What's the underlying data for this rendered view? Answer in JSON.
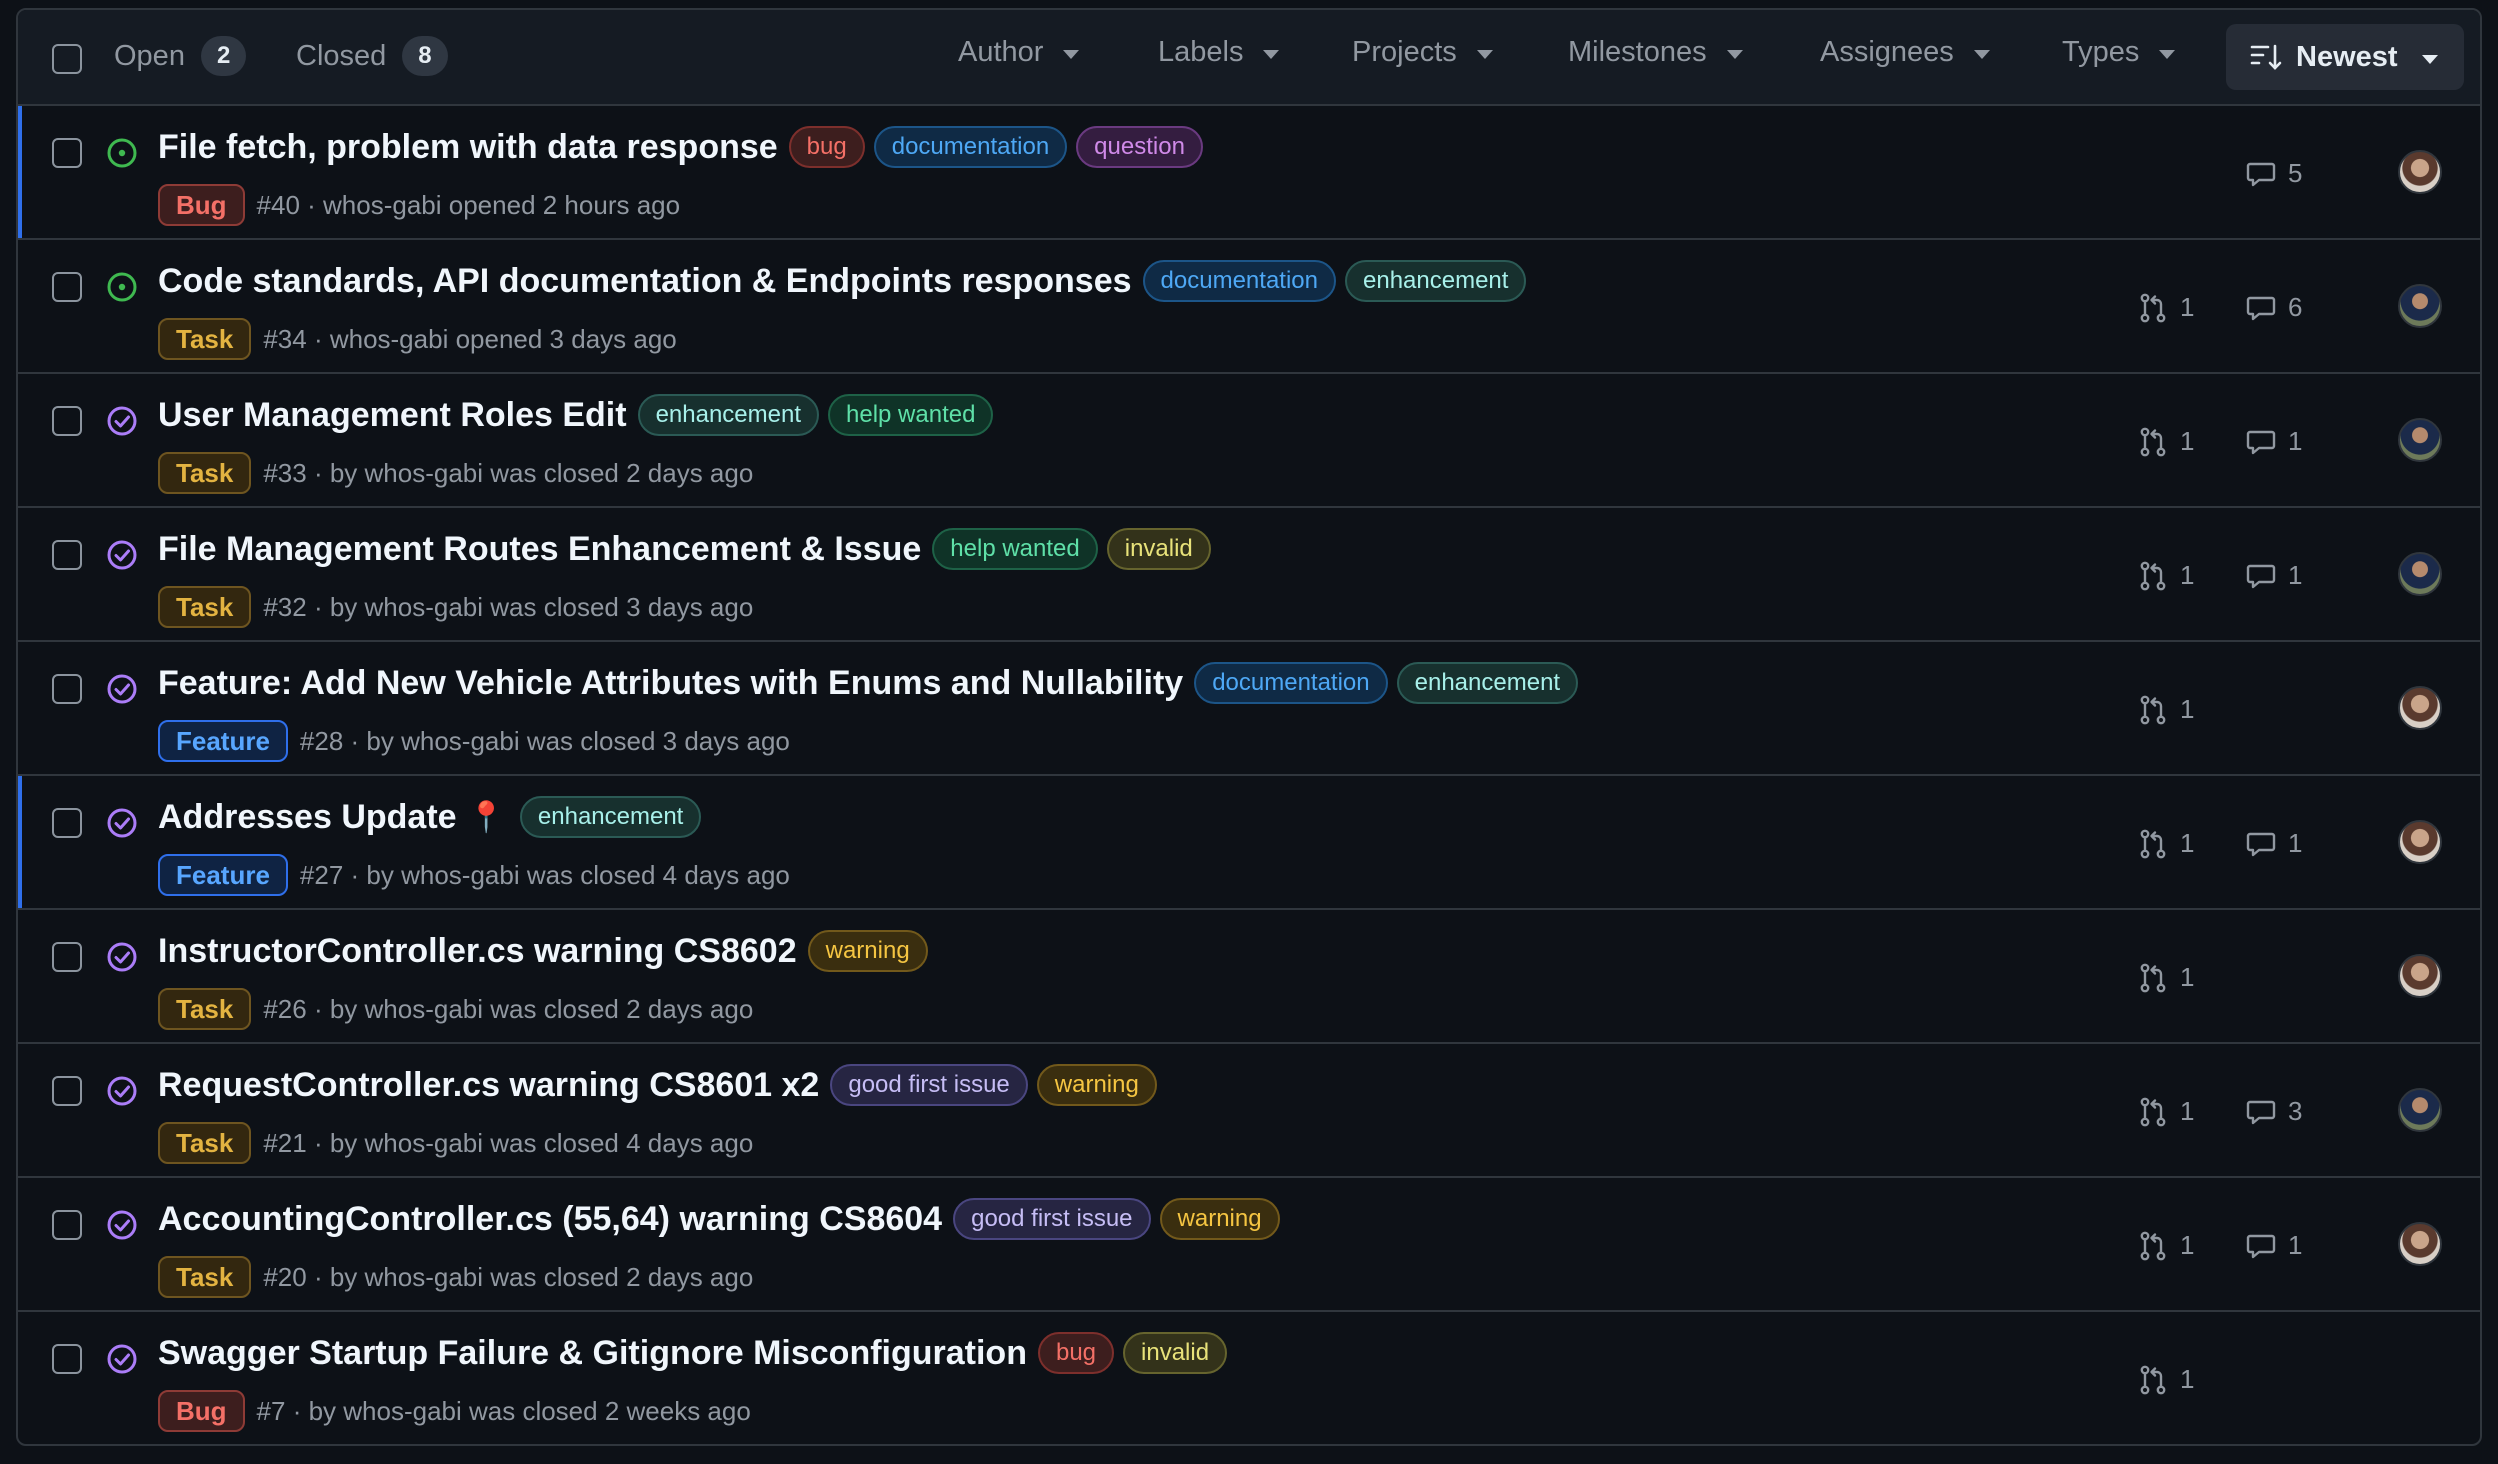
{
  "header": {
    "open_label": "Open",
    "open_count": "2",
    "closed_label": "Closed",
    "closed_count": "8",
    "filters": [
      "Author",
      "Labels",
      "Projects",
      "Milestones",
      "Assignees",
      "Types"
    ],
    "sort_label": "Newest"
  },
  "label_colors": {
    "bug": {
      "fg": "#f47067",
      "bg": "#3d1e1e",
      "border": "#7d2f2c"
    },
    "documentation": {
      "fg": "#4ea8f5",
      "bg": "#0f2a45",
      "border": "#1c5588"
    },
    "question": {
      "fg": "#d08ae8",
      "bg": "#341d40",
      "border": "#6a3a80"
    },
    "enhancement": {
      "fg": "#a8f0ea",
      "bg": "#17302e",
      "border": "#2b5a55"
    },
    "help wanted": {
      "fg": "#5fe0a8",
      "bg": "#0f3327",
      "border": "#1e6247"
    },
    "invalid": {
      "fg": "#e8e27a",
      "bg": "#33321a",
      "border": "#66642e"
    },
    "warning": {
      "fg": "#f5c542",
      "bg": "#3a2e0f",
      "border": "#72591b"
    },
    "good first issue": {
      "fg": "#c6bdf5",
      "bg": "#262542",
      "border": "#4a4680"
    }
  },
  "type_colors": {
    "Bug": {
      "fg": "#f47067",
      "bg": "#3d1e1e",
      "border": "#8e3b36"
    },
    "Task": {
      "fg": "#e3b341",
      "bg": "#33270f",
      "border": "#6e5520"
    },
    "Feature": {
      "fg": "#58a6ff",
      "bg": "#0f2343",
      "border": "#2f6feb"
    }
  },
  "issues": [
    {
      "title": "File fetch, problem with data response",
      "state": "open",
      "labels": [
        "bug",
        "documentation",
        "question"
      ],
      "type": "Bug",
      "meta": "#40 · whos-gabi opened 2 hours ago",
      "prs": null,
      "comments": "5",
      "avatar": "a1",
      "accent": true
    },
    {
      "title": "Code standards, API documentation & Endpoints responses",
      "state": "open",
      "labels": [
        "documentation",
        "enhancement"
      ],
      "type": "Task",
      "meta": "#34 · whos-gabi opened 3 days ago",
      "prs": "1",
      "comments": "6",
      "avatar": "a2",
      "accent": false
    },
    {
      "title": "User Management Roles Edit",
      "state": "closed",
      "labels": [
        "enhancement",
        "help wanted"
      ],
      "type": "Task",
      "meta": "#33 · by whos-gabi was closed 2 days ago",
      "prs": "1",
      "comments": "1",
      "avatar": "a2",
      "accent": false
    },
    {
      "title": "File Management Routes Enhancement & Issue",
      "state": "closed",
      "labels": [
        "help wanted",
        "invalid"
      ],
      "type": "Task",
      "meta": "#32 · by whos-gabi was closed 3 days ago",
      "prs": "1",
      "comments": "1",
      "avatar": "a2",
      "accent": false
    },
    {
      "title": "Feature: Add New Vehicle Attributes with Enums and Nullability",
      "state": "closed",
      "labels": [
        "documentation",
        "enhancement"
      ],
      "type": "Feature",
      "meta": "#28 · by whos-gabi was closed 3 days ago",
      "prs": "1",
      "comments": null,
      "avatar": "a1",
      "accent": false
    },
    {
      "title": "Addresses Update",
      "emoji": "📍",
      "state": "closed",
      "labels": [
        "enhancement"
      ],
      "type": "Feature",
      "meta": "#27 · by whos-gabi was closed 4 days ago",
      "prs": "1",
      "comments": "1",
      "avatar": "a1",
      "accent": true
    },
    {
      "title": "InstructorController.cs warning CS8602",
      "state": "closed",
      "labels": [
        "warning"
      ],
      "type": "Task",
      "meta": "#26 · by whos-gabi was closed 2 days ago",
      "prs": "1",
      "comments": null,
      "avatar": "a1",
      "accent": false
    },
    {
      "title": "RequestController.cs warning CS8601 x2",
      "state": "closed",
      "labels": [
        "good first issue",
        "warning"
      ],
      "type": "Task",
      "meta": "#21 · by whos-gabi was closed 4 days ago",
      "prs": "1",
      "comments": "3",
      "avatar": "a2",
      "accent": false
    },
    {
      "title": "AccountingController.cs (55,64) warning CS8604",
      "state": "closed",
      "labels": [
        "good first issue",
        "warning"
      ],
      "type": "Task",
      "meta": "#20 · by whos-gabi was closed 2 days ago",
      "prs": "1",
      "comments": "1",
      "avatar": "a1",
      "accent": false
    },
    {
      "title": "Swagger Startup Failure & Gitignore Misconfiguration",
      "state": "closed",
      "labels": [
        "bug",
        "invalid"
      ],
      "type": "Bug",
      "meta": "#7 · by whos-gabi was closed 2 weeks ago",
      "prs": "1",
      "comments": null,
      "avatar": null,
      "accent": false
    }
  ]
}
